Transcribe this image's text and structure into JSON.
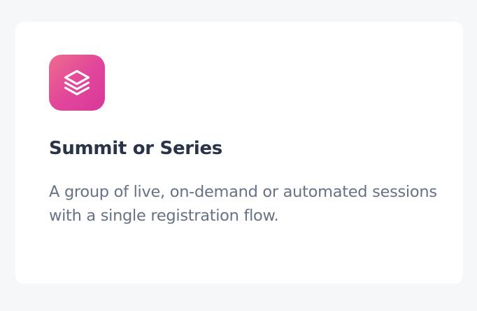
{
  "card": {
    "icon": "stack-layers-icon",
    "icon_gradient": [
      "#ee6d8e",
      "#d8379b"
    ],
    "title": "Summit or Series",
    "description": "A group of live, on-demand or automated sessions with a single registration flow."
  }
}
